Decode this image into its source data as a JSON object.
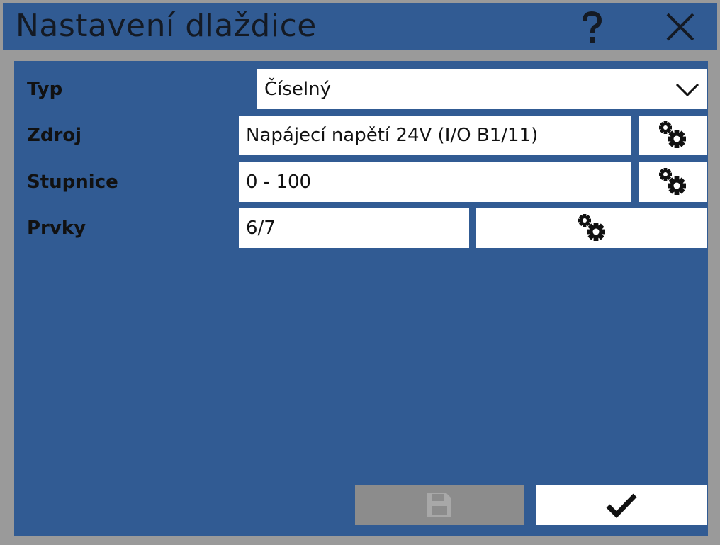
{
  "window": {
    "title": "Nastavení dlaždice",
    "help_icon": "question-icon",
    "close_icon": "close-icon"
  },
  "form": {
    "type": {
      "label": "Typ",
      "value": "Číselný",
      "icon": "chevron-down-icon"
    },
    "source": {
      "label": "Zdroj",
      "value": "Napájecí napětí 24V (I/O B1/11)",
      "icon": "gears-icon"
    },
    "scale": {
      "label": "Stupnice",
      "value": "0 - 100",
      "icon": "gears-icon"
    },
    "items": {
      "label": "Prvky",
      "value": "6/7",
      "icon": "gears-icon"
    }
  },
  "footer": {
    "save_icon": "save-icon",
    "save_state": "disabled",
    "ok_icon": "checkmark-icon"
  },
  "colors": {
    "window_frame": "#9a9a9a",
    "panel_blue": "#315b93",
    "field_bg": "#ffffff",
    "disabled_button": "#8c8c8c",
    "text": "#111111"
  }
}
